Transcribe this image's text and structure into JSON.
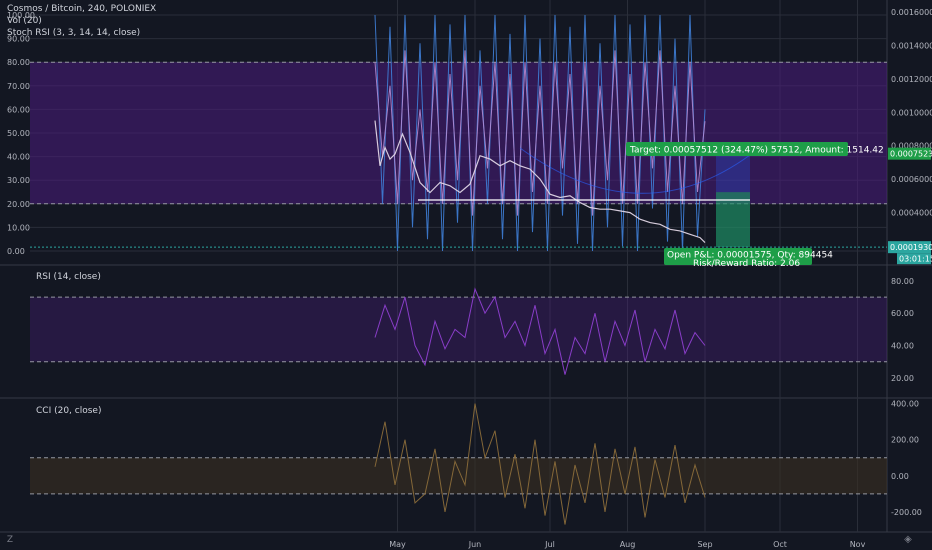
{
  "header": {
    "symbol_line": "Cosmos / Bitcoin, 240, POLONIEX",
    "vol_line": "Vol (20)",
    "stoch_line": "Stoch RSI (3, 3, 14, 14, close)"
  },
  "colors": {
    "background": "#131722",
    "grid": "#2a2e39",
    "purple_band": "#4a1c7e",
    "stoch_k": "#3f7fd8",
    "stoch_d": "#b48bd3",
    "price_line": "#e0d6e6",
    "rsi_line": "#8e3fd0",
    "cci_line": "#8a6b3a",
    "green": "#1e9e48",
    "teal": "#2ba6a0"
  },
  "chart_data": [
    {
      "type": "line",
      "pane": "main",
      "title": "Cosmos / Bitcoin, 240, POLONIEX",
      "left_axis_ticks": [
        "100.00",
        "90.00",
        "80.00",
        "70.00",
        "60.00",
        "50.00",
        "40.00",
        "30.00",
        "20.00",
        "10.00",
        "0.00"
      ],
      "left_axis_range": [
        0,
        100
      ],
      "right_axis_ticks": [
        "0.00160000",
        "0.00140000",
        "0.00120000",
        "0.00100000",
        "0.00080000",
        "0.00060000",
        "0.00040000"
      ],
      "right_axis_range": [
        0.00017,
        0.0016
      ],
      "band": [
        20,
        80
      ],
      "price_series": {
        "x": [
          "2019-04-22",
          "2019-04-24",
          "2019-04-26",
          "2019-04-28",
          "2019-04-30",
          "2019-05-03",
          "2019-05-06",
          "2019-05-10",
          "2019-05-14",
          "2019-05-18",
          "2019-05-22",
          "2019-05-26",
          "2019-05-30",
          "2019-06-03",
          "2019-06-07",
          "2019-06-11",
          "2019-06-15",
          "2019-06-19",
          "2019-06-23",
          "2019-06-27",
          "2019-07-01",
          "2019-07-05",
          "2019-07-09",
          "2019-07-13",
          "2019-07-17",
          "2019-07-21",
          "2019-07-25",
          "2019-07-29",
          "2019-08-02",
          "2019-08-06",
          "2019-08-10",
          "2019-08-14",
          "2019-08-18",
          "2019-08-22",
          "2019-08-26",
          "2019-08-30",
          "2019-09-01"
        ],
        "y": [
          0.00095,
          0.00068,
          0.00079,
          0.00072,
          0.00075,
          0.00087,
          0.00076,
          0.00058,
          0.00052,
          0.00058,
          0.00056,
          0.00052,
          0.00057,
          0.00074,
          0.00072,
          0.00068,
          0.00071,
          0.00068,
          0.00066,
          0.0006,
          0.00051,
          0.00049,
          0.0005,
          0.00046,
          0.00043,
          0.00042,
          0.00042,
          0.00041,
          0.0004,
          0.00036,
          0.00034,
          0.00033,
          0.0003,
          0.00029,
          0.00027,
          0.00025,
          0.00022
        ]
      },
      "stoch_series": {
        "x": [
          "2019-04-22",
          "2019-04-25",
          "2019-04-28",
          "2019-05-01",
          "2019-05-04",
          "2019-05-07",
          "2019-05-10",
          "2019-05-13",
          "2019-05-16",
          "2019-05-19",
          "2019-05-22",
          "2019-05-25",
          "2019-05-28",
          "2019-05-31",
          "2019-06-03",
          "2019-06-06",
          "2019-06-09",
          "2019-06-12",
          "2019-06-15",
          "2019-06-18",
          "2019-06-21",
          "2019-06-24",
          "2019-06-27",
          "2019-06-30",
          "2019-07-03",
          "2019-07-06",
          "2019-07-09",
          "2019-07-12",
          "2019-07-15",
          "2019-07-18",
          "2019-07-21",
          "2019-07-24",
          "2019-07-27",
          "2019-07-30",
          "2019-08-02",
          "2019-08-05",
          "2019-08-08",
          "2019-08-11",
          "2019-08-14",
          "2019-08-17",
          "2019-08-20",
          "2019-08-23",
          "2019-08-26",
          "2019-08-29",
          "2019-09-01"
        ],
        "k": [
          100,
          20,
          95,
          0,
          100,
          10,
          88,
          5,
          100,
          0,
          96,
          12,
          100,
          0,
          85,
          20,
          100,
          5,
          92,
          0,
          100,
          8,
          90,
          0,
          100,
          15,
          95,
          3,
          100,
          0,
          88,
          10,
          100,
          2,
          96,
          0,
          100,
          18,
          100,
          4,
          90,
          0,
          100,
          6,
          60
        ],
        "d": [
          80,
          40,
          70,
          20,
          85,
          30,
          60,
          25,
          80,
          20,
          75,
          30,
          85,
          15,
          70,
          35,
          80,
          20,
          75,
          15,
          80,
          25,
          70,
          20,
          80,
          35,
          75,
          20,
          80,
          15,
          70,
          30,
          85,
          20,
          75,
          20,
          80,
          35,
          85,
          25,
          70,
          20,
          80,
          25,
          55
        ]
      },
      "position": {
        "target_label": "Target: 0.00057512 (324.47%) 57512, Amount: 1514.42",
        "stop_label": "Open P&L: 0.00001575, Qty: 894454",
        "ratio_label": "Risk/Reward Ratio: 2.06",
        "target_price_tag": "0.00075237",
        "entry_price_tag": "0.00019300",
        "countdown_tag": "03:01:15"
      }
    },
    {
      "type": "line",
      "pane": "rsi",
      "title": "RSI (14, close)",
      "axis_ticks": [
        "80.00",
        "60.00",
        "40.00",
        "20.00"
      ],
      "axis_range": [
        10,
        88
      ],
      "band": [
        30,
        70
      ],
      "x": [
        "2019-04-22",
        "2019-04-26",
        "2019-04-30",
        "2019-05-04",
        "2019-05-08",
        "2019-05-12",
        "2019-05-16",
        "2019-05-20",
        "2019-05-24",
        "2019-05-28",
        "2019-06-01",
        "2019-06-05",
        "2019-06-09",
        "2019-06-13",
        "2019-06-17",
        "2019-06-21",
        "2019-06-25",
        "2019-06-29",
        "2019-07-03",
        "2019-07-07",
        "2019-07-11",
        "2019-07-15",
        "2019-07-19",
        "2019-07-23",
        "2019-07-27",
        "2019-07-31",
        "2019-08-04",
        "2019-08-08",
        "2019-08-12",
        "2019-08-16",
        "2019-08-20",
        "2019-08-24",
        "2019-08-28",
        "2019-09-01"
      ],
      "values": [
        45,
        65,
        50,
        70,
        40,
        28,
        55,
        38,
        50,
        45,
        75,
        60,
        70,
        45,
        55,
        40,
        65,
        35,
        50,
        22,
        45,
        35,
        60,
        30,
        55,
        40,
        62,
        30,
        50,
        38,
        62,
        35,
        48,
        40
      ]
    },
    {
      "type": "line",
      "pane": "cci",
      "title": "CCI (20, close)",
      "axis_ticks": [
        "400.00",
        "200.00",
        "0.00",
        "-200.00"
      ],
      "axis_range": [
        -300,
        420
      ],
      "band": [
        -100,
        100
      ],
      "x": [
        "2019-04-22",
        "2019-04-26",
        "2019-04-30",
        "2019-05-04",
        "2019-05-08",
        "2019-05-12",
        "2019-05-16",
        "2019-05-20",
        "2019-05-24",
        "2019-05-28",
        "2019-06-01",
        "2019-06-05",
        "2019-06-09",
        "2019-06-13",
        "2019-06-17",
        "2019-06-21",
        "2019-06-25",
        "2019-06-29",
        "2019-07-03",
        "2019-07-07",
        "2019-07-11",
        "2019-07-15",
        "2019-07-19",
        "2019-07-23",
        "2019-07-27",
        "2019-07-31",
        "2019-08-04",
        "2019-08-08",
        "2019-08-12",
        "2019-08-16",
        "2019-08-20",
        "2019-08-24",
        "2019-08-28",
        "2019-09-01"
      ],
      "values": [
        50,
        300,
        -50,
        200,
        -150,
        -100,
        150,
        -200,
        80,
        -50,
        400,
        100,
        250,
        -120,
        120,
        -180,
        200,
        -220,
        80,
        -270,
        60,
        -150,
        180,
        -200,
        150,
        -100,
        160,
        -230,
        90,
        -120,
        170,
        -150,
        60,
        -120
      ]
    }
  ],
  "time_axis": {
    "labels": [
      "May",
      "Jun",
      "Jul",
      "Aug",
      "Sep",
      "Oct",
      "Nov"
    ],
    "label_dates": [
      "2019-05-01",
      "2019-06-01",
      "2019-07-01",
      "2019-08-01",
      "2019-09-01",
      "2019-10-01",
      "2019-11-01"
    ],
    "range": [
      "2019-04-22",
      "2019-11-12"
    ]
  },
  "footer": {
    "left_icon": "Z",
    "right_icon": "◈"
  }
}
